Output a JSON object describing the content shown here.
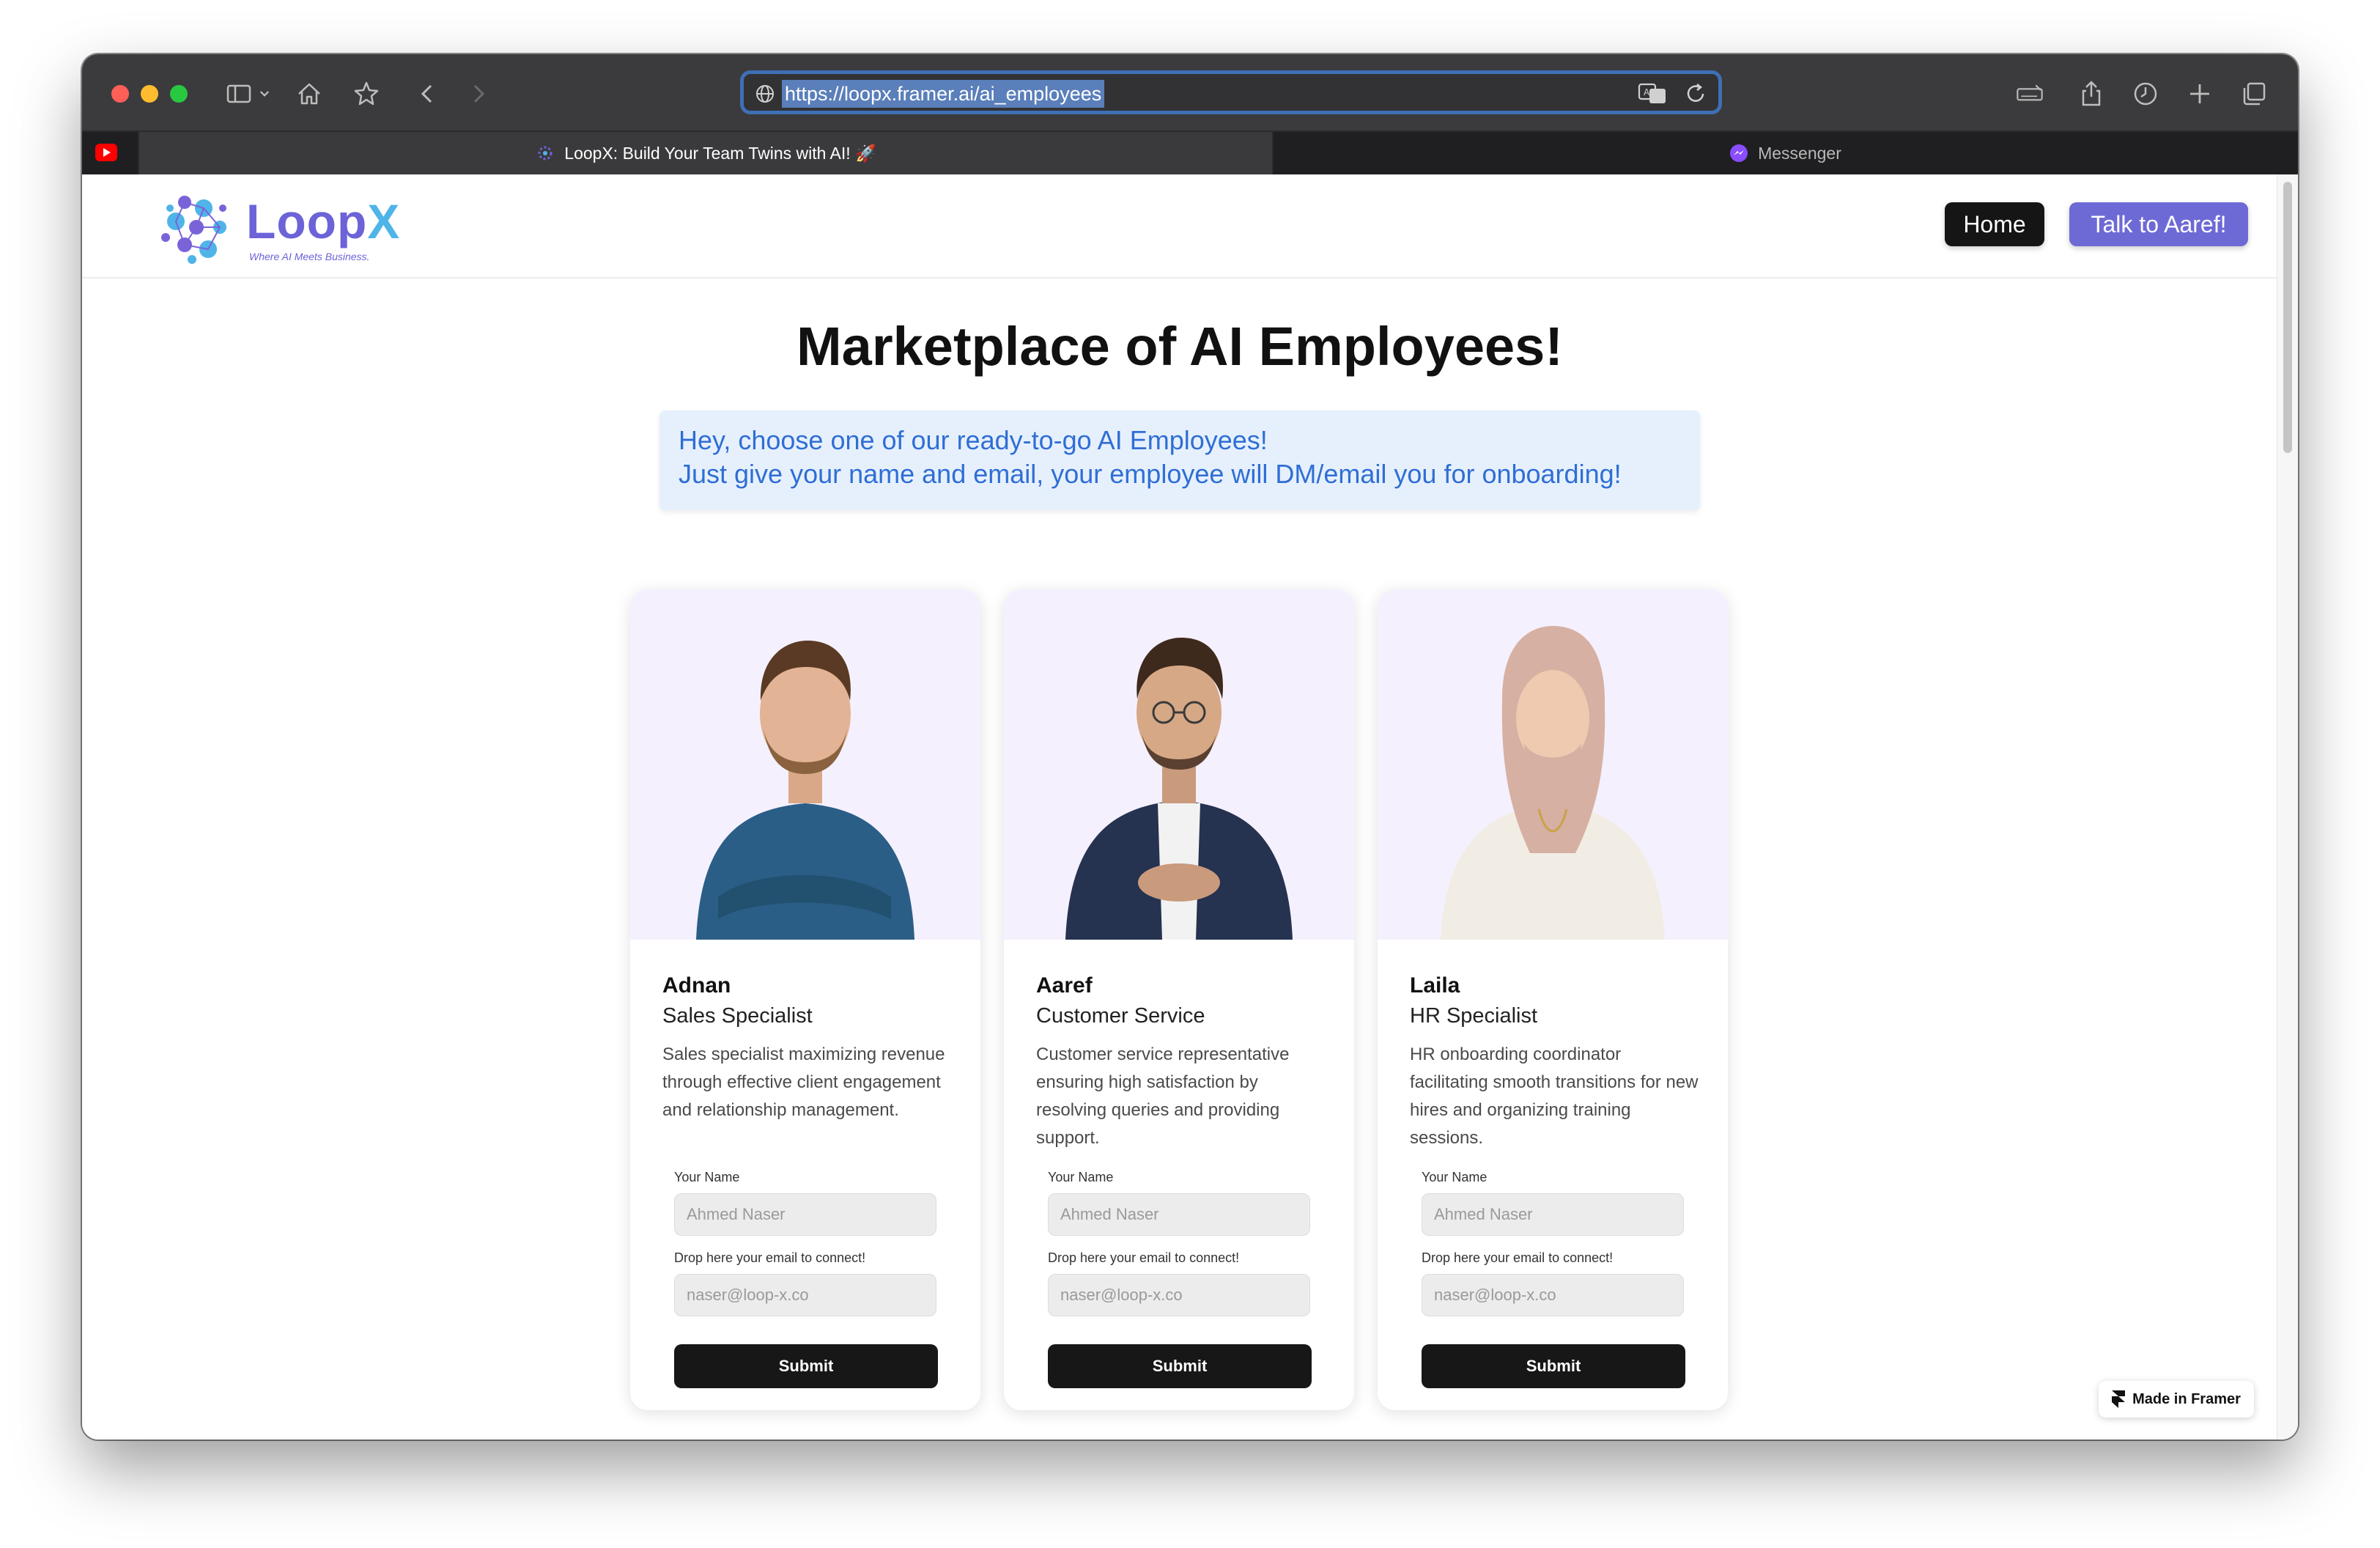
{
  "browser": {
    "url": "https://loopx.framer.ai/ai_employees",
    "tabs": [
      {
        "title": "LoopX: Build Your Team Twins with AI! 🚀",
        "active": true
      },
      {
        "title": "Messenger",
        "active": false
      }
    ]
  },
  "nav": {
    "logo_text": "LoopX",
    "logo_tagline": "Where AI Meets Business.",
    "home_label": "Home",
    "talk_label": "Talk to Aaref!"
  },
  "hero": {
    "title": "Marketplace of AI Employees!",
    "notice_line1": "Hey, choose one of our ready-to-go AI Employees!",
    "notice_line2": "Just give your name and email, your employee will DM/email you for onboarding!"
  },
  "cards": [
    {
      "name": "Adnan",
      "role": "Sales Specialist",
      "description": "Sales specialist maximizing revenue through effective client engagement and relationship management.",
      "name_label": "Your Name",
      "name_placeholder": "Ahmed Naser",
      "email_label": "Drop here your email to connect!",
      "email_placeholder": "naser@loop-x.co",
      "submit_label": "Submit"
    },
    {
      "name": "Aaref",
      "role": "Customer Service",
      "description": "Customer service representative ensuring high satisfaction by resolving queries and providing support.",
      "name_label": "Your Name",
      "name_placeholder": "Ahmed Naser",
      "email_label": "Drop here your email to connect!",
      "email_placeholder": "naser@loop-x.co",
      "submit_label": "Submit"
    },
    {
      "name": "Laila",
      "role": "HR Specialist",
      "description": "HR onboarding coordinator facilitating smooth transitions for new hires and organizing training sessions.",
      "name_label": "Your Name",
      "name_placeholder": "Ahmed Naser",
      "email_label": "Drop here your email to connect!",
      "email_placeholder": "naser@loop-x.co",
      "submit_label": "Submit"
    }
  ],
  "badge": {
    "label": "Made in Framer"
  },
  "colors": {
    "accent": "#6d6ad6",
    "dark": "#151515",
    "notice_bg": "#e6f0fd",
    "notice_text": "#2f6ed4",
    "card_photo_bg": "#f5f0fd"
  }
}
